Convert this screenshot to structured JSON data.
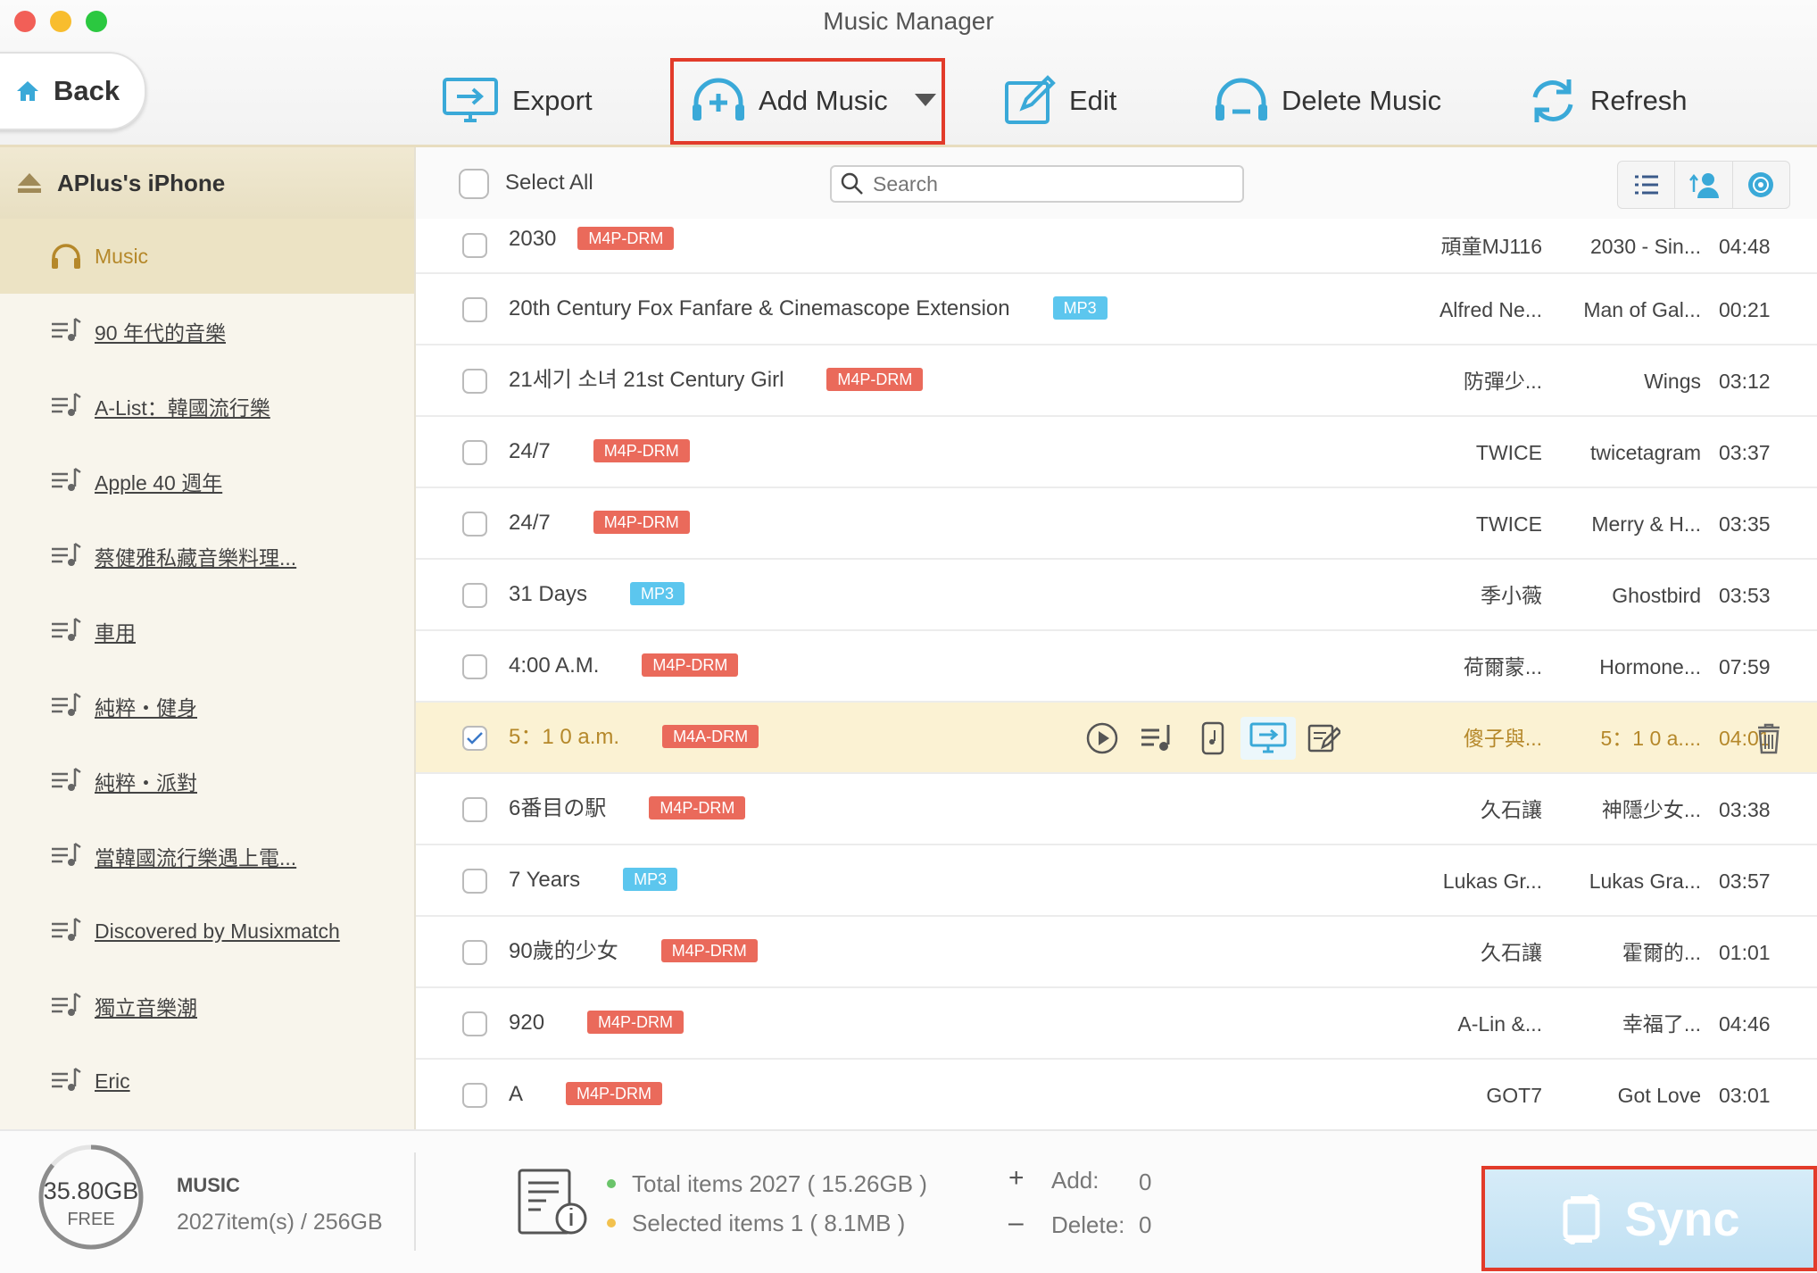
{
  "window": {
    "title": "Music Manager"
  },
  "nav": {
    "back_label": "Back"
  },
  "toolbar": {
    "export_label": "Export",
    "add_music_label": "Add Music",
    "edit_label": "Edit",
    "delete_label": "Delete Music",
    "refresh_label": "Refresh"
  },
  "sidebar": {
    "device_name": "APlus's iPhone",
    "items": [
      {
        "label": "Music",
        "icon": "headphones-icon",
        "active": true
      },
      {
        "label": "90 年代的音樂",
        "icon": "playlist-icon"
      },
      {
        "label": "A-List：韓國流行樂",
        "icon": "playlist-icon"
      },
      {
        "label": "Apple 40 週年",
        "icon": "playlist-icon"
      },
      {
        "label": "蔡健雅私藏音樂料理...",
        "icon": "playlist-icon"
      },
      {
        "label": "車用",
        "icon": "playlist-icon"
      },
      {
        "label": "純粹・健身",
        "icon": "playlist-icon"
      },
      {
        "label": "純粹・派對",
        "icon": "playlist-icon"
      },
      {
        "label": "當韓國流行樂遇上電...",
        "icon": "playlist-icon"
      },
      {
        "label": "Discovered by Musixmatch",
        "icon": "playlist-icon"
      },
      {
        "label": "獨立音樂潮",
        "icon": "playlist-icon"
      },
      {
        "label": "Eric",
        "icon": "playlist-icon"
      }
    ]
  },
  "list": {
    "select_all_label": "Select All",
    "search_placeholder": "Search",
    "rows": [
      {
        "title": "2030",
        "format": "M4P-DRM",
        "artist": "頑童MJ116",
        "album": "2030 - Sin...",
        "duration": "04:48",
        "checked": false
      },
      {
        "title": "20th Century Fox Fanfare & Cinemascope Extension",
        "format": "MP3",
        "artist": "Alfred Ne...",
        "album": "Man of Gal...",
        "duration": "00:21",
        "checked": false
      },
      {
        "title": "21세기 소녀 21st Century Girl",
        "format": "M4P-DRM",
        "artist": "防彈少...",
        "album": "Wings",
        "duration": "03:12",
        "checked": false
      },
      {
        "title": "24/7",
        "format": "M4P-DRM",
        "artist": "TWICE",
        "album": "twicetagram",
        "duration": "03:37",
        "checked": false
      },
      {
        "title": "24/7",
        "format": "M4P-DRM",
        "artist": "TWICE",
        "album": "Merry & H...",
        "duration": "03:35",
        "checked": false
      },
      {
        "title": "31 Days",
        "format": "MP3",
        "artist": "季小薇",
        "album": "Ghostbird",
        "duration": "03:53",
        "checked": false
      },
      {
        "title": "4:00 A.M.",
        "format": "M4P-DRM",
        "artist": "荷爾蒙...",
        "album": "Hormone...",
        "duration": "07:59",
        "checked": false
      },
      {
        "title": "5：1 0 a.m.",
        "format": "M4A-DRM",
        "artist": "傻子與...",
        "album": "5：1 0 a....",
        "duration": "04:01",
        "checked": true
      },
      {
        "title": "6番目の駅",
        "format": "M4P-DRM",
        "artist": "久石讓",
        "album": "神隱少女...",
        "duration": "03:38",
        "checked": false
      },
      {
        "title": "7 Years",
        "format": "MP3",
        "artist": "Lukas Gr...",
        "album": "Lukas Gra...",
        "duration": "03:57",
        "checked": false
      },
      {
        "title": "90歲的少女",
        "format": "M4P-DRM",
        "artist": "久石讓",
        "album": "霍爾的...",
        "duration": "01:01",
        "checked": false
      },
      {
        "title": "920",
        "format": "M4P-DRM",
        "artist": "A-Lin &...",
        "album": "幸福了...",
        "duration": "04:46",
        "checked": false
      },
      {
        "title": "A",
        "format": "M4P-DRM",
        "artist": "GOT7",
        "album": "Got Love",
        "duration": "03:01",
        "checked": false
      }
    ]
  },
  "footer": {
    "storage_free": "35.80GB",
    "storage_free_label": "FREE",
    "storage_fraction_used": 0.86,
    "category": "MUSIC",
    "category_detail": "2027item(s) / 256GB",
    "total_items": "Total items 2027 ( 15.26GB )",
    "selected_items": "Selected items 1 ( 8.1MB )",
    "add_label": "Add:",
    "add_value": "0",
    "delete_label": "Delete:",
    "delete_value": "0",
    "sync_label": "Sync"
  },
  "colors": {
    "accent_gold": "#b5882a",
    "drm_badge": "#ea6a5b",
    "mp3_badge": "#5cc6ee",
    "icon_blue": "#3aa9d8",
    "highlight_red": "#e23b2a"
  }
}
